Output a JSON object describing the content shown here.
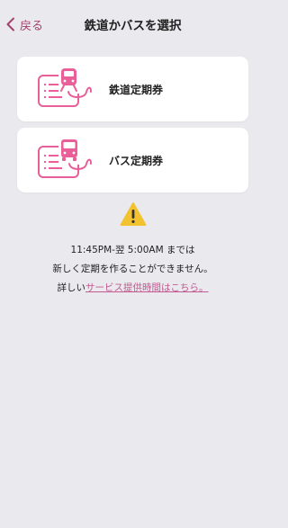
{
  "nav": {
    "back_label": "戻る",
    "title": "鉄道かバスを選択"
  },
  "options": [
    {
      "label": "鉄道定期券",
      "icon": "train-pass-icon"
    },
    {
      "label": "バス定期券",
      "icon": "bus-pass-icon"
    }
  ],
  "notice": {
    "icon": "warning-icon",
    "line1": "11:45PM-翌 5:00AM までは",
    "line2": "新しく定期を作ることができません。",
    "line3_prefix": "詳しい",
    "line3_link": "サービス提供時間はこちら。"
  },
  "colors": {
    "accent": "#a4426e",
    "icon_pink": "#e85f9a",
    "link": "#c05a90",
    "warning": "#f2c230",
    "background": "#eae9ee"
  }
}
